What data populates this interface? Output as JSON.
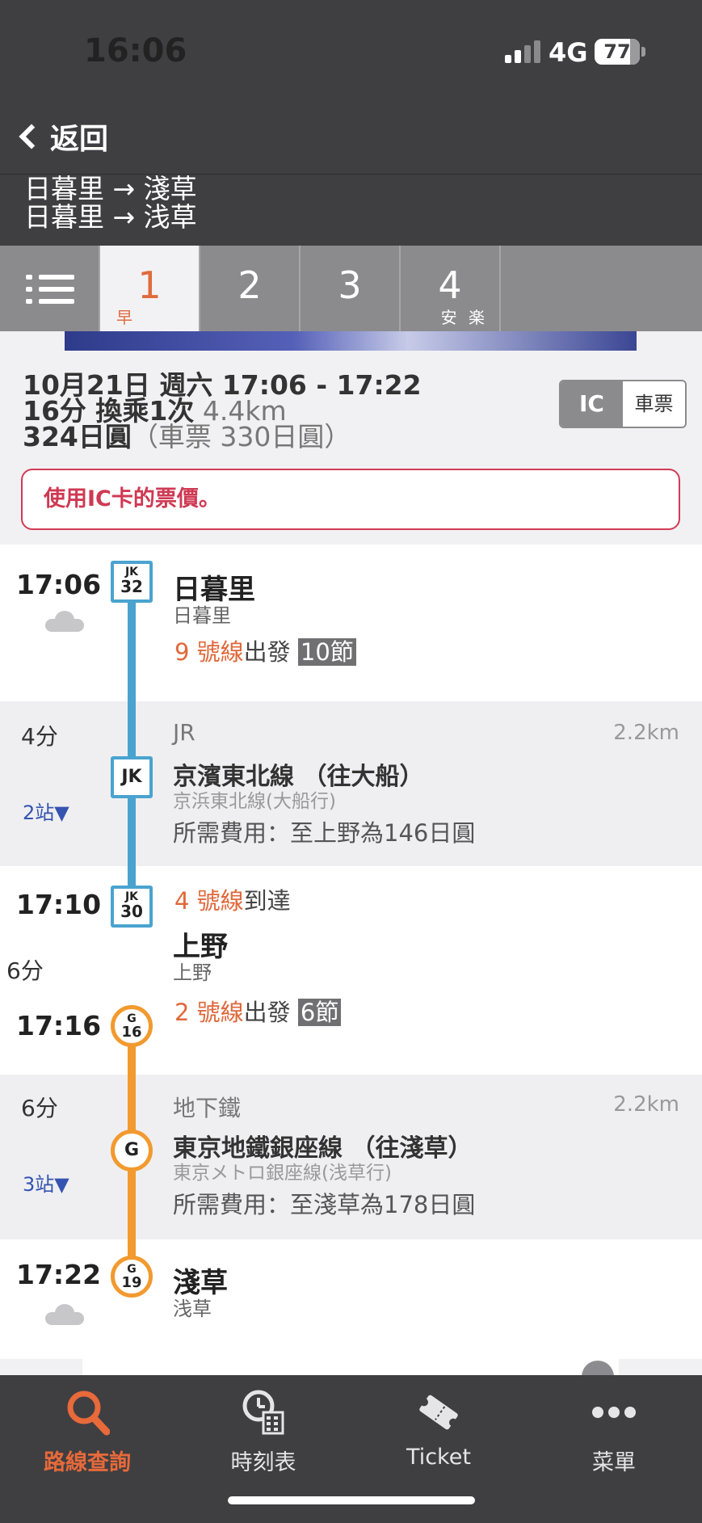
{
  "status_bar": {
    "time": "16:06",
    "network": "4G",
    "battery": "77"
  },
  "nav": {
    "back_label": "返回"
  },
  "route_header": {
    "line1": "日暮里 → 淺草",
    "line2": "日暮里 → 浅草"
  },
  "tabs": [
    {
      "num": "1",
      "sub": "早",
      "active": true
    },
    {
      "num": "2",
      "sub": ""
    },
    {
      "num": "3",
      "sub": ""
    },
    {
      "num": "4",
      "sub": "安 楽"
    }
  ],
  "summary": {
    "date_time": "10月21日 週六 17:06 - 17:22",
    "duration_transfer": "16分 換乘1次",
    "distance": "4.4km",
    "price": "324日圓",
    "ticket_price": "（車票 330日圓）",
    "toggle_ic": "IC",
    "toggle_ticket": "車票",
    "notice": "使用IC卡的票價。"
  },
  "timeline": {
    "stop1": {
      "time": "17:06",
      "badge_top": "JK",
      "badge_bottom": "32",
      "name": "日暮里",
      "sub": "日暮里",
      "platform_num": "9 號線",
      "platform_action": "出發",
      "cars": "10節"
    },
    "leg1": {
      "duration": "4分",
      "stops": "2站▼",
      "company": "JR",
      "distance": "2.2km",
      "badge": "JK",
      "line_name": "京濱東北線 （往大船）",
      "line_sub": "京浜東北線(大船行)",
      "fare": "所需費用：至上野為146日圓"
    },
    "stop2": {
      "arrive_time": "17:10",
      "badge_top": "JK",
      "badge_bottom": "30",
      "arrive_platform_num": "4 號線",
      "arrive_action": "到達",
      "name": "上野",
      "sub": "上野",
      "transfer_duration": "6分",
      "depart_time": "17:16",
      "badge2_top": "G",
      "badge2_bottom": "16",
      "depart_platform_num": "2 號線",
      "depart_action": "出發",
      "cars": "6節"
    },
    "leg2": {
      "duration": "6分",
      "stops": "3站▼",
      "company": "地下鐵",
      "distance": "2.2km",
      "badge": "G",
      "line_name": "東京地鐵銀座線 （往淺草）",
      "line_sub": "東京メトロ銀座線(浅草行)",
      "fare": "所需費用：至淺草為178日圓"
    },
    "stop3": {
      "time": "17:22",
      "badge_top": "G",
      "badge_bottom": "19",
      "name": "淺草",
      "sub": "浅草"
    }
  },
  "tabbar": {
    "search": "路線查詢",
    "timetable": "時刻表",
    "ticket": "Ticket",
    "menu": "菜單"
  },
  "colors": {
    "jr_keihin_tohoku": "#4aa3cf",
    "ginza_line": "#f29a2f",
    "accent": "#e8693a",
    "notice_red": "#cf3953"
  }
}
